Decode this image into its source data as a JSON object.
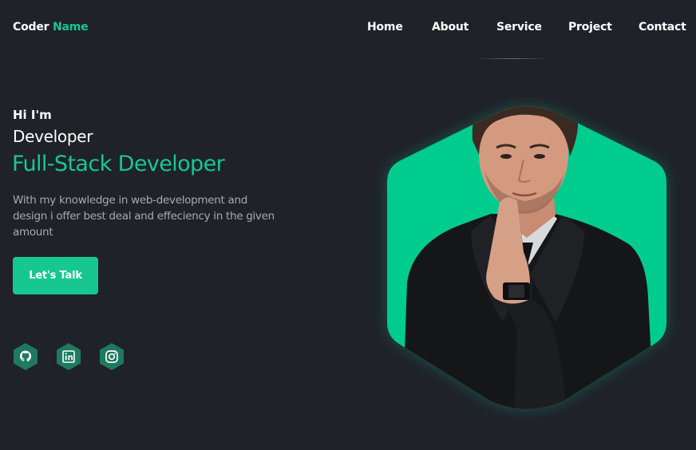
{
  "header": {
    "logo": {
      "first": "Coder",
      "second": "Name"
    },
    "nav": [
      "Home",
      "About",
      "Service",
      "Project",
      "Contact"
    ]
  },
  "hero": {
    "greeting": "Hi I'm",
    "role": "Developer",
    "headline": "Full-Stack Developer",
    "description": "With my knowledge in web-development and design i offer best deal and effeciency in the given amount",
    "cta_label": "Let's Talk"
  },
  "socials": [
    {
      "icon": "github-icon"
    },
    {
      "icon": "linkedin-icon"
    },
    {
      "icon": "instagram-icon"
    }
  ],
  "colors": {
    "background": "#1f2229",
    "accent": "#16c88f",
    "text": "#ffffff",
    "muted": "#a7aab2",
    "social_bg": "#1d7a5f"
  }
}
